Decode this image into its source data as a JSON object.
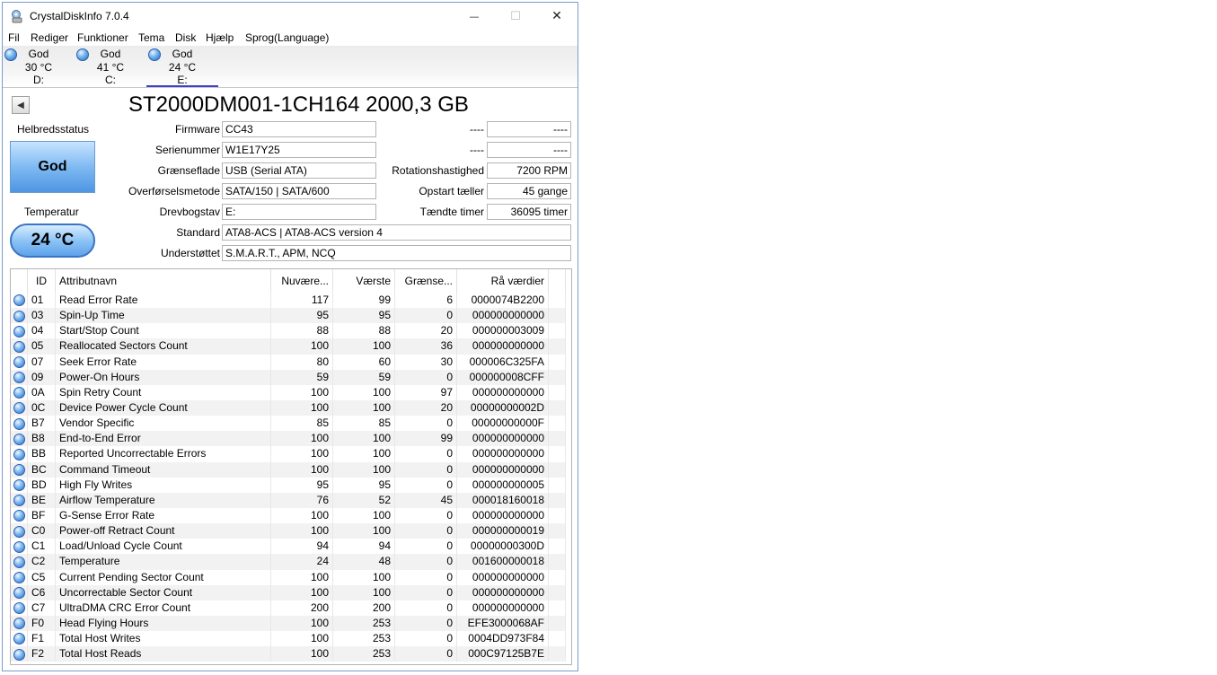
{
  "window": {
    "title": "CrystalDiskInfo 7.0.4",
    "min_glyph": "—",
    "max_glyph": "☐",
    "close_glyph": "✕"
  },
  "menu": [
    "Fil",
    "Rediger",
    "Funktioner",
    "Tema",
    "Disk",
    "Hjælp",
    "Sprog(Language)"
  ],
  "disks": [
    {
      "status": "God",
      "temp": "30 °C",
      "letter": "D:"
    },
    {
      "status": "God",
      "temp": "41 °C",
      "letter": "C:"
    },
    {
      "status": "God",
      "temp": "24 °C",
      "letter": "E:"
    }
  ],
  "disk_title": "ST2000DM001-1CH164 2000,3 GB",
  "nav_back_glyph": "◀",
  "health": {
    "label": "Helbredsstatus",
    "value": "God"
  },
  "temperature": {
    "label": "Temperatur",
    "value": "24 °C"
  },
  "fields": {
    "firmware": {
      "label": "Firmware",
      "value": "CC43"
    },
    "serial": {
      "label": "Serienummer",
      "value": "W1E17Y25"
    },
    "interface": {
      "label": "Grænseflade",
      "value": "USB (Serial ATA)"
    },
    "transfer": {
      "label": "Overførselsmetode",
      "value": "SATA/150 | SATA/600"
    },
    "drive_letter": {
      "label": "Drevbogstav",
      "value": "E:"
    },
    "standard": {
      "label": "Standard",
      "value": "ATA8-ACS | ATA8-ACS version 4"
    },
    "supported": {
      "label": "Understøttet",
      "value": "S.M.A.R.T., APM, NCQ"
    }
  },
  "right_fields": {
    "blank1": {
      "label": "----",
      "value": "----"
    },
    "blank2": {
      "label": "----",
      "value": "----"
    },
    "rotation": {
      "label": "Rotationshastighed",
      "value": "7200 RPM"
    },
    "power_count": {
      "label": "Opstart tæller",
      "value": "45 gange"
    },
    "power_hours": {
      "label": "Tændte timer",
      "value": "36095 timer"
    }
  },
  "table": {
    "headers": {
      "id": "ID",
      "name": "Attributnavn",
      "current": "Nuvære...",
      "worst": "Værste",
      "threshold": "Grænse...",
      "raw": "Rå værdier"
    },
    "rows": [
      {
        "id": "01",
        "name": "Read Error Rate",
        "current": "117",
        "worst": "99",
        "threshold": "6",
        "raw": "0000074B2200"
      },
      {
        "id": "03",
        "name": "Spin-Up Time",
        "current": "95",
        "worst": "95",
        "threshold": "0",
        "raw": "000000000000"
      },
      {
        "id": "04",
        "name": "Start/Stop Count",
        "current": "88",
        "worst": "88",
        "threshold": "20",
        "raw": "000000003009"
      },
      {
        "id": "05",
        "name": "Reallocated Sectors Count",
        "current": "100",
        "worst": "100",
        "threshold": "36",
        "raw": "000000000000"
      },
      {
        "id": "07",
        "name": "Seek Error Rate",
        "current": "80",
        "worst": "60",
        "threshold": "30",
        "raw": "000006C325FA"
      },
      {
        "id": "09",
        "name": "Power-On Hours",
        "current": "59",
        "worst": "59",
        "threshold": "0",
        "raw": "000000008CFF"
      },
      {
        "id": "0A",
        "name": "Spin Retry Count",
        "current": "100",
        "worst": "100",
        "threshold": "97",
        "raw": "000000000000"
      },
      {
        "id": "0C",
        "name": "Device Power Cycle Count",
        "current": "100",
        "worst": "100",
        "threshold": "20",
        "raw": "00000000002D"
      },
      {
        "id": "B7",
        "name": "Vendor Specific",
        "current": "85",
        "worst": "85",
        "threshold": "0",
        "raw": "00000000000F"
      },
      {
        "id": "B8",
        "name": "End-to-End Error",
        "current": "100",
        "worst": "100",
        "threshold": "99",
        "raw": "000000000000"
      },
      {
        "id": "BB",
        "name": "Reported Uncorrectable Errors",
        "current": "100",
        "worst": "100",
        "threshold": "0",
        "raw": "000000000000"
      },
      {
        "id": "BC",
        "name": "Command Timeout",
        "current": "100",
        "worst": "100",
        "threshold": "0",
        "raw": "000000000000"
      },
      {
        "id": "BD",
        "name": "High Fly Writes",
        "current": "95",
        "worst": "95",
        "threshold": "0",
        "raw": "000000000005"
      },
      {
        "id": "BE",
        "name": "Airflow Temperature",
        "current": "76",
        "worst": "52",
        "threshold": "45",
        "raw": "000018160018"
      },
      {
        "id": "BF",
        "name": "G-Sense Error Rate",
        "current": "100",
        "worst": "100",
        "threshold": "0",
        "raw": "000000000000"
      },
      {
        "id": "C0",
        "name": "Power-off Retract Count",
        "current": "100",
        "worst": "100",
        "threshold": "0",
        "raw": "000000000019"
      },
      {
        "id": "C1",
        "name": "Load/Unload Cycle Count",
        "current": "94",
        "worst": "94",
        "threshold": "0",
        "raw": "00000000300D"
      },
      {
        "id": "C2",
        "name": "Temperature",
        "current": "24",
        "worst": "48",
        "threshold": "0",
        "raw": "001600000018"
      },
      {
        "id": "C5",
        "name": "Current Pending Sector Count",
        "current": "100",
        "worst": "100",
        "threshold": "0",
        "raw": "000000000000"
      },
      {
        "id": "C6",
        "name": "Uncorrectable Sector Count",
        "current": "100",
        "worst": "100",
        "threshold": "0",
        "raw": "000000000000"
      },
      {
        "id": "C7",
        "name": "UltraDMA CRC Error Count",
        "current": "200",
        "worst": "200",
        "threshold": "0",
        "raw": "000000000000"
      },
      {
        "id": "F0",
        "name": "Head Flying Hours",
        "current": "100",
        "worst": "253",
        "threshold": "0",
        "raw": "EFE3000068AF"
      },
      {
        "id": "F1",
        "name": "Total Host Writes",
        "current": "100",
        "worst": "253",
        "threshold": "0",
        "raw": "0004DD973F84"
      },
      {
        "id": "F2",
        "name": "Total Host Reads",
        "current": "100",
        "worst": "253",
        "threshold": "0",
        "raw": "000C97125B7E"
      }
    ]
  }
}
